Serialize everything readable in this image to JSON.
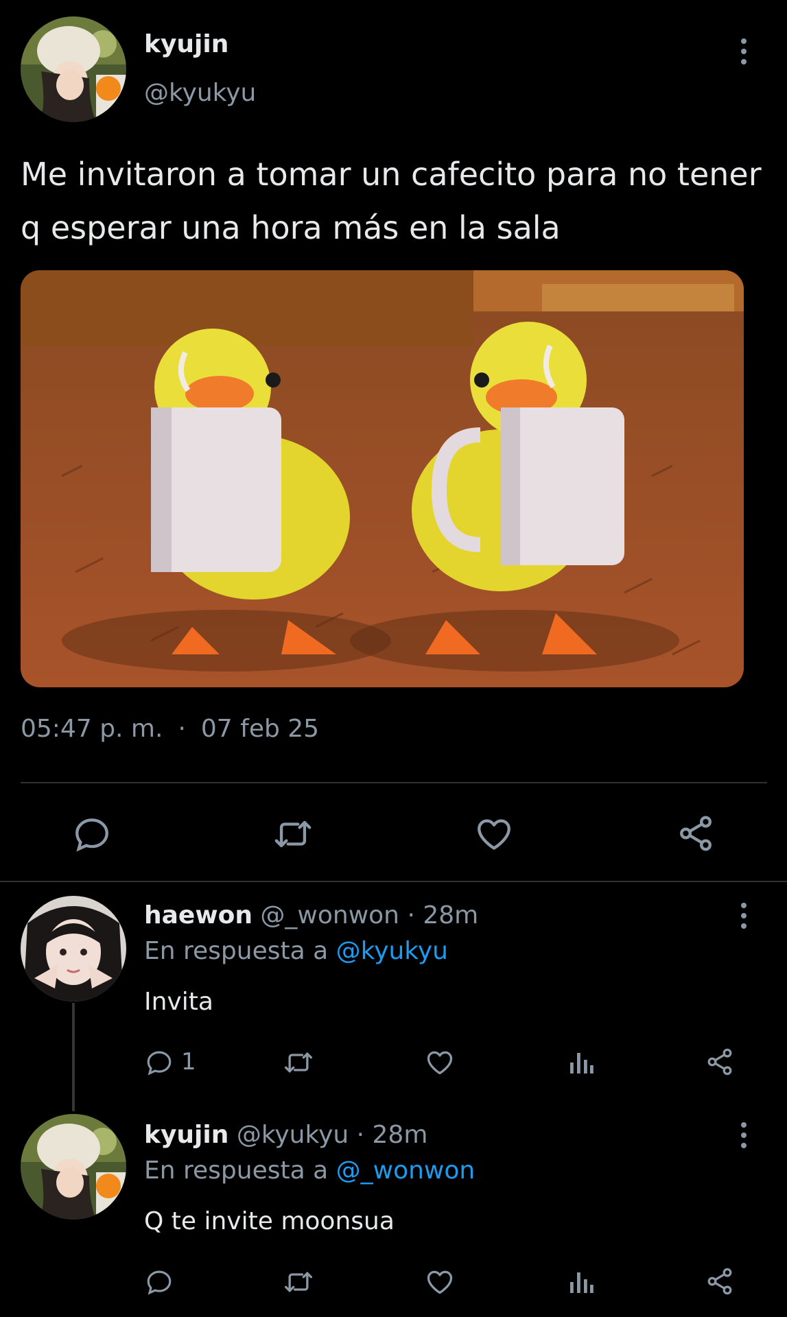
{
  "main_tweet": {
    "display_name": "kyujin",
    "handle": "@kyukyu",
    "text": "Me invitaron a tomar un cafecito para no tener q esperar una hora más en la sala",
    "time": "05:47 p. m.",
    "separator": "·",
    "date": "07 feb 25",
    "avatar_icon": "avatar-photo",
    "actions": [
      "reply-icon",
      "retweet-icon",
      "like-icon",
      "share-icon"
    ]
  },
  "replies": [
    {
      "display_name": "haewon",
      "handle": "@_wonwon",
      "age": "· 28m",
      "reply_prefix": "En respuesta a",
      "reply_to": "@kyukyu",
      "text": "Invita",
      "reply_count": "1",
      "actions": [
        "reply-icon",
        "retweet-icon",
        "like-icon",
        "views-icon",
        "share-icon"
      ]
    },
    {
      "display_name": "kyujin",
      "handle": "@kyukyu",
      "age": "· 28m",
      "reply_prefix": "En respuesta a",
      "reply_to": "@_wonwon",
      "text": "Q te invite moonsua",
      "reply_count": "",
      "actions": [
        "reply-icon",
        "retweet-icon",
        "like-icon",
        "views-icon",
        "share-icon"
      ]
    }
  ],
  "colors": {
    "background": "#000000",
    "text": "#e7e9ea",
    "muted": "#8b98a5",
    "link": "#1d9bf0",
    "divider": "#2f3336"
  }
}
